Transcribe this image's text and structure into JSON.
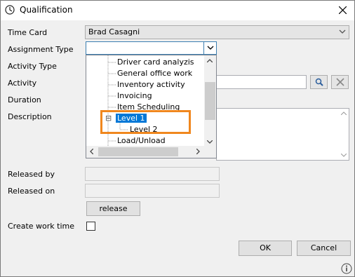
{
  "window": {
    "title": "Qualification"
  },
  "labels": {
    "time_card": "Time Card",
    "assignment_type": "Assignment Type",
    "activity_type": "Activity Type",
    "activity": "Activity",
    "duration": "Duration",
    "description": "Description",
    "released_by": "Released by",
    "released_on": "Released on",
    "create_work_time": "Create work time"
  },
  "fields": {
    "time_card_value": "Brad Casagni",
    "assignment_type_value": "",
    "create_work_time_checked": false
  },
  "tree": {
    "items": [
      {
        "label": "Driver card analyzis",
        "selected": false
      },
      {
        "label": "General office work",
        "selected": false
      },
      {
        "label": "Inventory activity",
        "selected": false
      },
      {
        "label": "Invoicing",
        "selected": false
      },
      {
        "label": "Item Scheduling",
        "selected": false
      },
      {
        "label": "Level 1",
        "selected": true
      },
      {
        "label": "Level 2",
        "selected": false
      },
      {
        "label": "Load/Unload",
        "selected": false
      }
    ],
    "expanded_glyph": "⊟"
  },
  "buttons": {
    "release": "release",
    "ok": "OK",
    "cancel": "Cancel"
  },
  "icons": {
    "title": "clock-icon",
    "close": "close-icon",
    "search": "search-icon",
    "clear": "clear-x-icon",
    "info": "info-icon"
  },
  "colors": {
    "selection": "#0078d7",
    "highlight": "#f0871e"
  }
}
